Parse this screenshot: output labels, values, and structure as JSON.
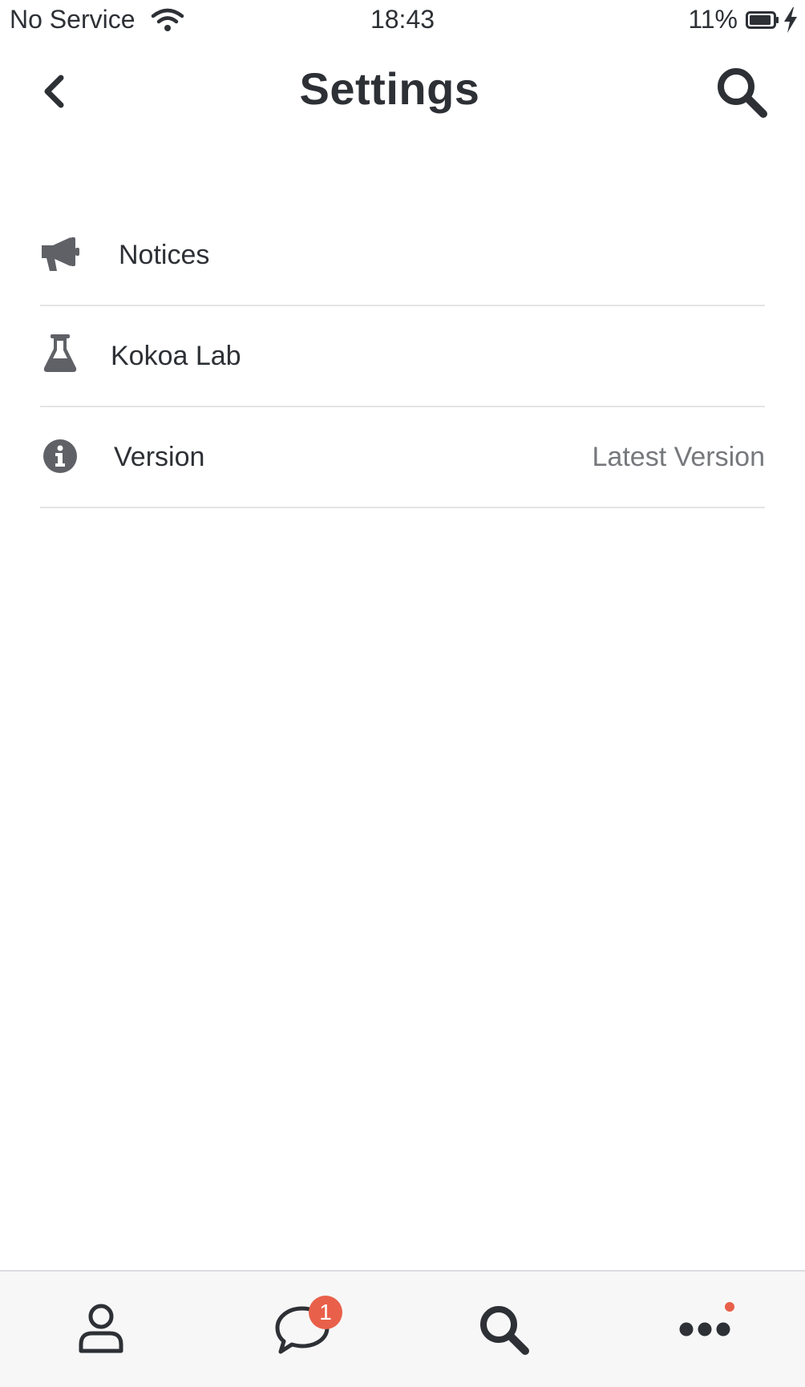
{
  "status_bar": {
    "carrier": "No Service",
    "time": "18:43",
    "battery": "11%"
  },
  "header": {
    "title": "Settings",
    "back_icon": "chevron-left-icon",
    "search_icon": "search-icon"
  },
  "settings": {
    "items": [
      {
        "label": "Notices",
        "icon": "megaphone-icon",
        "value": ""
      },
      {
        "label": "Kokoa Lab",
        "icon": "flask-icon",
        "value": ""
      },
      {
        "label": "Version",
        "icon": "info-icon",
        "value": "Latest Version"
      }
    ]
  },
  "tab_bar": {
    "tabs": [
      {
        "icon": "person-icon"
      },
      {
        "icon": "chat-bubble-icon",
        "badge": "1"
      },
      {
        "icon": "search-icon"
      },
      {
        "icon": "more-icon",
        "has_dot": true
      }
    ]
  },
  "colors": {
    "text_primary": "#2d3035",
    "text_secondary": "#76787c",
    "icon_gray": "#5f6166",
    "divider": "#e4e5e7",
    "tab_bar_bg": "#f7f7f8",
    "badge": "#e9604a"
  }
}
